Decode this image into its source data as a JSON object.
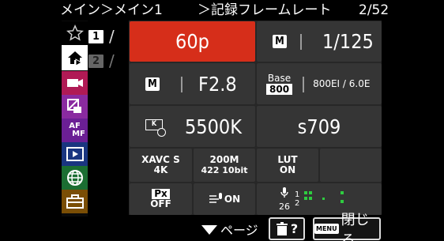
{
  "header": {
    "breadcrumb": "メイン＞メイン1",
    "title": "＞記録フレームレート",
    "page": "2/52"
  },
  "left_icons": [
    "star-icon",
    "home-icon",
    "movie-icon",
    "picture-icon",
    "afmf-icon",
    "play-icon",
    "network-icon",
    "toolbox-icon"
  ],
  "sub_tabs": [
    {
      "label": "1"
    },
    {
      "label": "2"
    }
  ],
  "cells": {
    "frame_rate": "60p",
    "shutter_mode_badge": "M",
    "shutter_speed": "1/125",
    "aperture_mode_badge": "M",
    "aperture": "F2.8",
    "base_label": "Base",
    "base_value": "800",
    "base_ei": "800EI / 6.0E",
    "wb_badge": "K",
    "white_balance": "5500K",
    "picture_profile": "s709",
    "codec_line1": "XAVC S",
    "codec_line2": "4K",
    "bitrate_line1": "200M",
    "bitrate_line2": "422 10bit",
    "lut_line1": "LUT",
    "lut_line2": "ON",
    "px_badge": "Px",
    "px_value": "OFF",
    "wind_value": "ON",
    "mic_level": "26",
    "ch1": "1",
    "ch2": "2"
  },
  "footer": {
    "page_label": "ページ",
    "help_label": "?",
    "menu_badge": "MENU",
    "close_label": "閉じる"
  },
  "colors": {
    "selected": "#d62e1a",
    "tab_home_bg": "#ffffff",
    "cat_movie": "#c2185b",
    "cat_picture": "#8e24aa",
    "cat_af": "#6a1b9a",
    "cat_play": "#1e3a8a",
    "cat_network": "#1b7a3a",
    "cat_toolbox": "#8a5a0a"
  }
}
